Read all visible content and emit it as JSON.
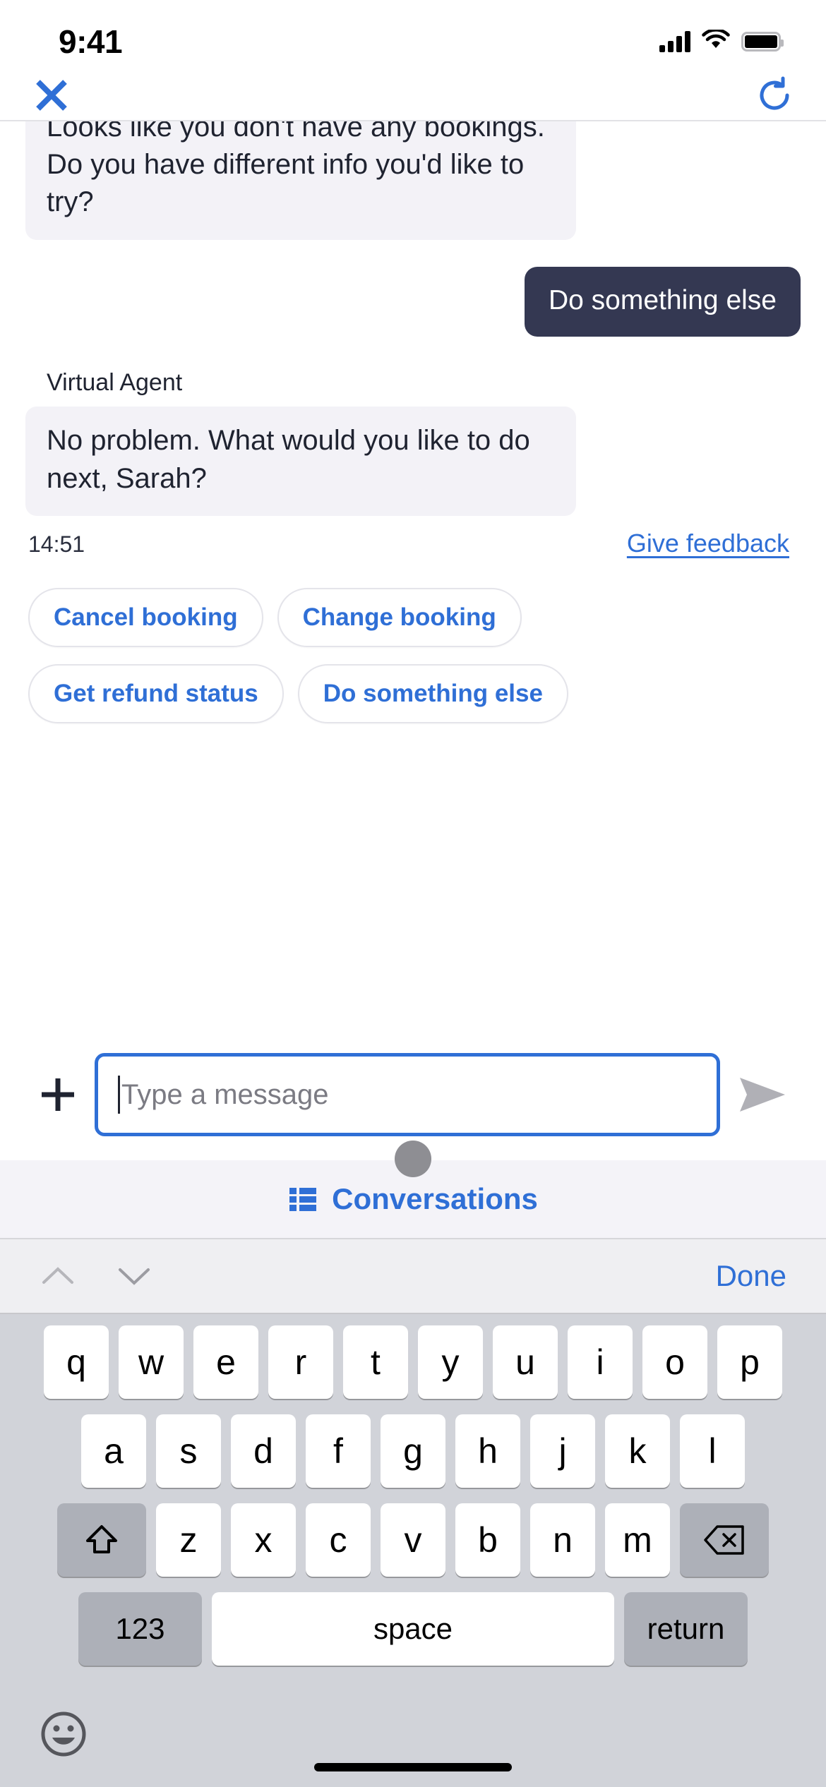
{
  "status_bar": {
    "time": "9:41",
    "signal_icon": "cellular-signal-icon",
    "wifi_icon": "wifi-icon",
    "battery_icon": "battery-icon"
  },
  "navbar": {
    "close_icon": "close-icon",
    "refresh_icon": "refresh-icon"
  },
  "conversation": {
    "messages": [
      {
        "role": "agent",
        "text": "Looks like you don't have any bookings. Do you have different info you'd like to try?",
        "clipped": true
      },
      {
        "role": "user",
        "text": "Do something else"
      },
      {
        "role": "agent",
        "sender": "Virtual Agent",
        "text": "No problem. What would you like to do next, Sarah?"
      }
    ],
    "timestamp": "14:51",
    "feedback_label": "Give feedback"
  },
  "quick_replies": [
    "Cancel booking",
    "Change booking",
    "Get refund status",
    "Do something else"
  ],
  "composer": {
    "add_icon": "plus-icon",
    "input_value": "",
    "input_placeholder": "Type a message",
    "send_icon": "send-icon"
  },
  "conversations_bar": {
    "label": "Conversations",
    "icon": "list-icon",
    "handle": "drag-handle"
  },
  "keyboard_accessory": {
    "prev_icon": "chevron-up-icon",
    "next_icon": "chevron-down-icon",
    "done_label": "Done"
  },
  "keyboard": {
    "row1": [
      "q",
      "w",
      "e",
      "r",
      "t",
      "y",
      "u",
      "i",
      "o",
      "p"
    ],
    "row2": [
      "a",
      "s",
      "d",
      "f",
      "g",
      "h",
      "j",
      "k",
      "l"
    ],
    "row3": [
      "z",
      "x",
      "c",
      "v",
      "b",
      "n",
      "m"
    ],
    "shift_icon": "shift-icon",
    "backspace_icon": "backspace-icon",
    "numbers_label": "123",
    "space_label": "space",
    "return_label": "return",
    "emoji_icon": "emoji-icon"
  },
  "colors": {
    "accent_blue": "#2f6fd6",
    "user_bubble": "#343852",
    "agent_bubble": "#f3f2f7",
    "keyboard_bg": "#d1d3d9"
  }
}
